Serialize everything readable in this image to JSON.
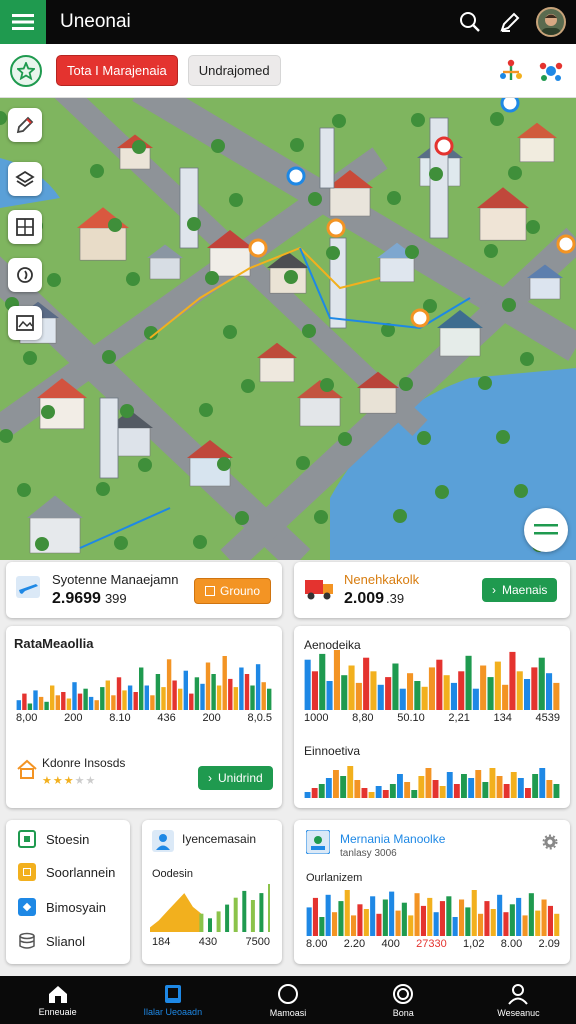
{
  "header": {
    "title": "Uneonai",
    "icons": [
      "menu-icon",
      "search-icon",
      "edit-icon",
      "avatar"
    ]
  },
  "filterbar": {
    "chip_active": "Tota I Marajenaia",
    "chip_inactive": "Undrajomed",
    "icons": [
      "star-icon",
      "tree-network-icon",
      "share-dots-icon"
    ]
  },
  "map": {
    "tools": [
      "pencil-icon",
      "layers-icon",
      "grid-icon",
      "target-icon",
      "image-icon"
    ],
    "fab": "menu-lines-icon"
  },
  "cards": {
    "system": {
      "title": "Syotenne Manaejamn",
      "value": "2.9699",
      "suffix": "399",
      "button": "Grouno"
    },
    "vehicle": {
      "title": "Nenehkakolk",
      "value": "2.009",
      "suffix": ".39",
      "button": "Maenais"
    },
    "rata": {
      "title": "RataMeaollia",
      "ticks": [
        "8,00",
        "200",
        "8.10",
        "436",
        "200",
        "8,0.5"
      ]
    },
    "apod": {
      "title": "Aenodeika",
      "ticks": [
        "1000",
        "8,80",
        "50.10",
        "2,21",
        "134",
        "4539"
      ],
      "sub": "Einnoetiva"
    },
    "insights": {
      "title": "Kdonre Insosds",
      "button": "Unidrind",
      "rating": 3
    },
    "side": {
      "items": [
        "Stoesin",
        "Soorlannein",
        "Bimosyain",
        "Slianol"
      ]
    },
    "event": {
      "title": "Iyencemasain",
      "sub": "Oodesin",
      "ticks": [
        "184",
        "430",
        "7500"
      ]
    },
    "manual": {
      "title": "Mernania Manoolke",
      "sub": "tanlasy 3006",
      "section": "Ourlanizem",
      "ticks": [
        "8.00",
        "2.20",
        "400",
        "27330",
        "1,02",
        "8.00",
        "2.09"
      ]
    }
  },
  "bottomnav": {
    "items": [
      "Enneuaie",
      "Ilalar Ueoaadn",
      "Mamoasi",
      "Bona",
      "Weseanuc"
    ]
  },
  "colors": {
    "green": "#1f9a4f",
    "red": "#e4332f",
    "orange": "#f39424",
    "blue": "#1e88e5",
    "yellow": "#f2b01e"
  },
  "chart_data": [
    {
      "type": "bar",
      "title": "RataMeaollia",
      "series": [
        {
          "values": [
            12,
            20,
            8,
            24,
            16,
            10,
            30,
            18,
            22,
            14,
            34,
            20,
            26,
            16,
            12,
            28,
            36,
            18,
            40,
            24,
            30,
            22,
            52,
            30,
            18,
            44,
            28,
            62,
            36,
            26,
            48,
            20,
            40,
            32,
            58,
            44,
            30,
            66,
            38,
            28,
            52,
            44,
            30,
            56,
            34,
            26
          ]
        }
      ]
    },
    {
      "type": "bar",
      "title": "Aenodeika",
      "series": [
        {
          "values": [
            52,
            40,
            58,
            30,
            62,
            36,
            46,
            28,
            54,
            40,
            26,
            34,
            48,
            22,
            38,
            30,
            24,
            44,
            52,
            36,
            28,
            40,
            56,
            22,
            46,
            34,
            50,
            26,
            60,
            40,
            32,
            44,
            54,
            38,
            28
          ]
        }
      ]
    },
    {
      "type": "bar",
      "title": "Einnoetiva",
      "series": [
        {
          "values": [
            6,
            10,
            14,
            20,
            28,
            22,
            32,
            18,
            10,
            6,
            12,
            8,
            14,
            24,
            16,
            8,
            22,
            30,
            18,
            12,
            26,
            14,
            24,
            20,
            28,
            16,
            30,
            22,
            14,
            26,
            20,
            10,
            24,
            30,
            18,
            14
          ]
        }
      ]
    },
    {
      "type": "area",
      "title": "Iyencemasain",
      "series": [
        {
          "values": [
            4,
            10,
            18,
            26,
            34,
            22,
            16,
            12,
            18,
            24,
            30,
            36,
            28,
            34,
            42
          ]
        }
      ]
    },
    {
      "type": "bar",
      "title": "Ourlanizem",
      "series": [
        {
          "values": [
            36,
            48,
            24,
            52,
            30,
            44,
            58,
            26,
            40,
            34,
            50,
            28,
            46,
            56,
            32,
            42,
            26,
            54,
            38,
            48,
            30,
            44,
            50,
            24,
            46,
            36,
            58,
            28,
            44,
            34,
            52,
            30,
            40,
            48,
            26,
            54,
            32,
            46,
            38,
            28
          ]
        }
      ]
    }
  ]
}
